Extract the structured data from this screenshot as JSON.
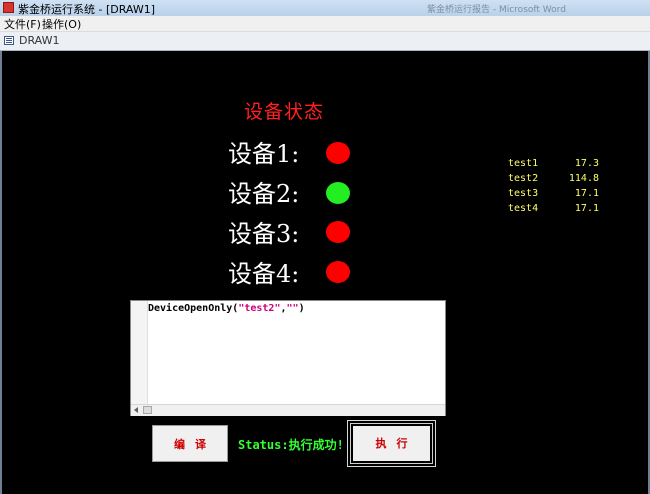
{
  "window": {
    "title": "紫金桥运行系统 - [DRAW1]",
    "background_title_fragment": "紫金桥运行报告 - Microsoft Word"
  },
  "menu": {
    "items": [
      {
        "label": "文件(F)"
      },
      {
        "label": "操作(O)"
      }
    ]
  },
  "document_tab": {
    "label": "DRAW1"
  },
  "panel": {
    "title": "设备状态",
    "title_color": "#ff2020",
    "devices": [
      {
        "label": "设备1:",
        "status_color": "#ff0000"
      },
      {
        "label": "设备2:",
        "status_color": "#22ee22"
      },
      {
        "label": "设备3:",
        "status_color": "#ff0000"
      },
      {
        "label": "设备4:",
        "status_color": "#ff0000"
      }
    ]
  },
  "readings": [
    {
      "name": "test1",
      "value": "17.3"
    },
    {
      "name": "test2",
      "value": "114.8"
    },
    {
      "name": "test3",
      "value": "17.1"
    },
    {
      "name": "test4",
      "value": "17.1"
    }
  ],
  "editor": {
    "func": "DeviceOpenOnly",
    "open_paren": "(",
    "arg1": "\"test2\"",
    "comma": ",",
    "arg2": "\"\"",
    "close_paren": ")"
  },
  "buttons": {
    "compile_label": "编译",
    "execute_label": "执行"
  },
  "status": {
    "text": "Status:执行成功!",
    "color": "#33ff33"
  }
}
